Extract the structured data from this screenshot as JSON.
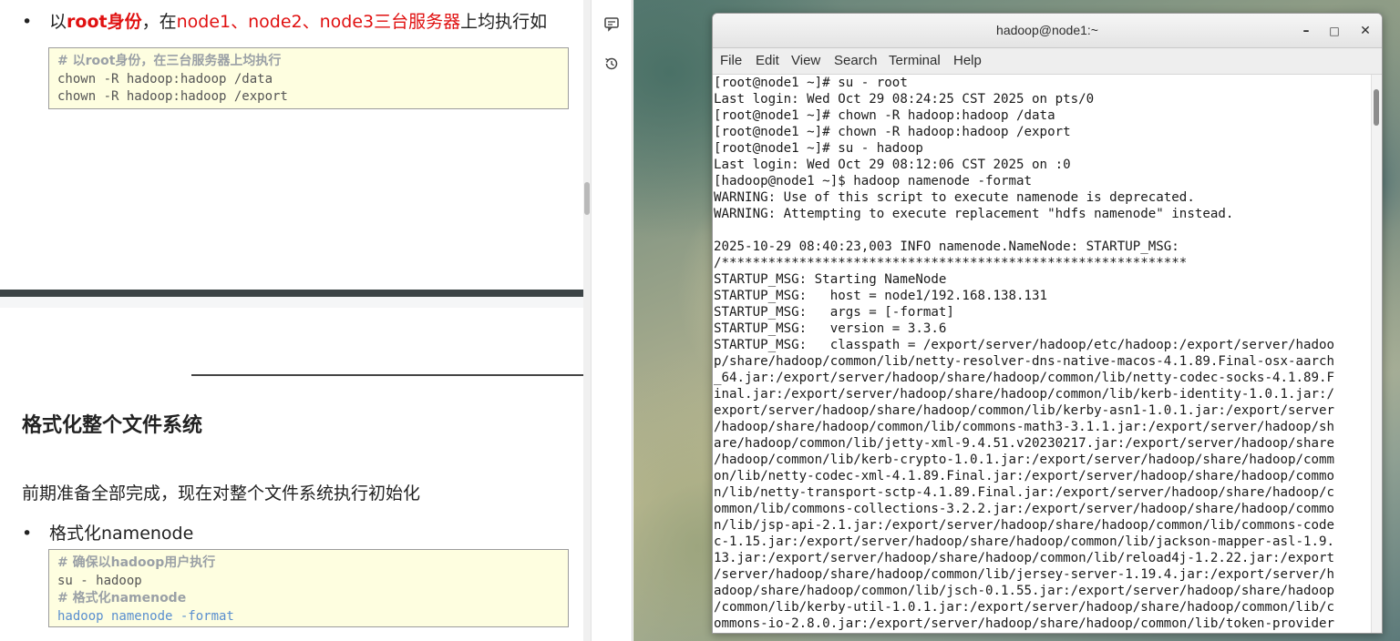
{
  "doc": {
    "bullet1": {
      "prefix": "以",
      "role": "root身份",
      "mid": "，在",
      "nodes": "node1、node2、node3三台服务器",
      "suffix": "上均执行如"
    },
    "code1": {
      "comment": "# 以root身份，在三台服务器上均执行",
      "lines": [
        "chown -R hadoop:hadoop /data",
        "chown -R hadoop:hadoop /export"
      ]
    },
    "heading": "格式化整个文件系统",
    "paragraph": "前期准备全部完成，现在对整个文件系统执行初始化",
    "bullet2": "格式化namenode",
    "code2": {
      "comment1": "# 确保以hadoop用户执行",
      "line1": "su - hadoop",
      "comment2": "# 格式化namenode",
      "line2": "hadoop namenode -format"
    }
  },
  "tools": {
    "icons": [
      "comment-icon",
      "history-icon"
    ]
  },
  "terminal": {
    "title": "hadoop@node1:~",
    "window_buttons": {
      "minimize": "–",
      "maximize": "□",
      "close": "✕"
    },
    "menu": [
      "File",
      "Edit",
      "View",
      "Search",
      "Terminal",
      "Help"
    ],
    "lines": [
      "[root@node1 ~]# su - root",
      "Last login: Wed Oct 29 08:24:25 CST 2025 on pts/0",
      "[root@node1 ~]# chown -R hadoop:hadoop /data",
      "[root@node1 ~]# chown -R hadoop:hadoop /export",
      "[root@node1 ~]# su - hadoop",
      "Last login: Wed Oct 29 08:12:06 CST 2025 on :0",
      "[hadoop@node1 ~]$ hadoop namenode -format",
      "WARNING: Use of this script to execute namenode is deprecated.",
      "WARNING: Attempting to execute replacement \"hdfs namenode\" instead.",
      "",
      "2025-10-29 08:40:23,003 INFO namenode.NameNode: STARTUP_MSG:",
      "/************************************************************",
      "STARTUP_MSG: Starting NameNode",
      "STARTUP_MSG:   host = node1/192.168.138.131",
      "STARTUP_MSG:   args = [-format]",
      "STARTUP_MSG:   version = 3.3.6",
      "STARTUP_MSG:   classpath = /export/server/hadoop/etc/hadoop:/export/server/hadoo",
      "p/share/hadoop/common/lib/netty-resolver-dns-native-macos-4.1.89.Final-osx-aarch",
      "_64.jar:/export/server/hadoop/share/hadoop/common/lib/netty-codec-socks-4.1.89.F",
      "inal.jar:/export/server/hadoop/share/hadoop/common/lib/kerb-identity-1.0.1.jar:/",
      "export/server/hadoop/share/hadoop/common/lib/kerby-asn1-1.0.1.jar:/export/server",
      "/hadoop/share/hadoop/common/lib/commons-math3-3.1.1.jar:/export/server/hadoop/sh",
      "are/hadoop/common/lib/jetty-xml-9.4.51.v20230217.jar:/export/server/hadoop/share",
      "/hadoop/common/lib/kerb-crypto-1.0.1.jar:/export/server/hadoop/share/hadoop/comm",
      "on/lib/netty-codec-xml-4.1.89.Final.jar:/export/server/hadoop/share/hadoop/commo",
      "n/lib/netty-transport-sctp-4.1.89.Final.jar:/export/server/hadoop/share/hadoop/c",
      "ommon/lib/commons-collections-3.2.2.jar:/export/server/hadoop/share/hadoop/commo",
      "n/lib/jsp-api-2.1.jar:/export/server/hadoop/share/hadoop/common/lib/commons-code",
      "c-1.15.jar:/export/server/hadoop/share/hadoop/common/lib/jackson-mapper-asl-1.9.",
      "13.jar:/export/server/hadoop/share/hadoop/common/lib/reload4j-1.2.22.jar:/export",
      "/server/hadoop/share/hadoop/common/lib/jersey-server-1.19.4.jar:/export/server/h",
      "adoop/share/hadoop/common/lib/jsch-0.1.55.jar:/export/server/hadoop/share/hadoop",
      "/common/lib/kerby-util-1.0.1.jar:/export/server/hadoop/share/hadoop/common/lib/c",
      "ommons-io-2.8.0.jar:/export/server/hadoop/share/hadoop/common/lib/token-provider"
    ]
  }
}
